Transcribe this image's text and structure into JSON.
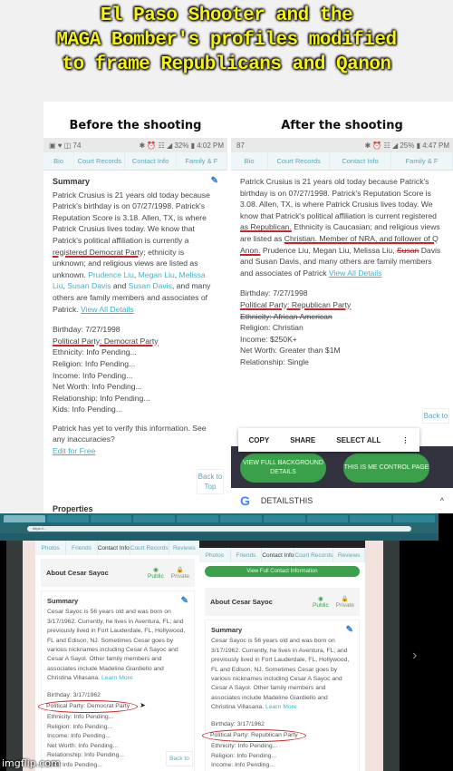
{
  "meme": {
    "title_lines": [
      "El Paso Shooter and the",
      "MAGA Bomber's profiles modified",
      "to frame Republicans and Qanon"
    ],
    "watermark": "imgflip.com",
    "accent_title_color": "#f5f21a",
    "annotation_color": "#c9242b"
  },
  "before": {
    "heading": "Before the shooting",
    "status": {
      "left": "▣ ♥ ◫ 74",
      "right": "✱ ⏰ ☷ ◢ 32% ▮ 4:02 PM"
    },
    "tabs": [
      "Bio",
      "Court Records",
      "Contact Info",
      "Family & F"
    ],
    "summary_label": "Summary",
    "summary": {
      "p1": "Patrick Crusius is 21 years old today because Patrick's birthday is on 07/27/1998. Patrick's Reputation Score is 3.18. Allen, TX, is where Patrick Crusius lives today. We know that Patrick's political affiliation is currently a ",
      "underlined": "registered Democrat Party",
      "p2": "; ethnicity is unknown; and religious views are listed as unknown. ",
      "rel1": "Prudence Liu",
      "rel2": "Megan Liu",
      "rel3": "Melissa Liu",
      "rel4": "Susan Davis",
      "and": " and ",
      "rel5": "Susan Davis",
      "p3": ", and many others are family members and associates of Patrick. ",
      "view_all": "View All Details"
    },
    "facts": [
      "Birthday: 7/27/1998",
      "Political Party: Democrat Party",
      "Ethnicity: Info Pending...",
      "Religion: Info Pending...",
      "Income: Info Pending...",
      "Net Worth: Info Pending...",
      "Relationship: Info Pending...",
      "Kids: Info Pending..."
    ],
    "verify_note": "Patrick has yet to verify this information. See any inaccuracies?",
    "edit_link": "Edit for Free",
    "back_to_top": "Back to Top",
    "properties_label": "Properties"
  },
  "after": {
    "heading": "After the shooting",
    "status": {
      "left": "87",
      "right": "✱ ⏰ ☷ ◢ 25% ▮ 4:47 PM"
    },
    "tabs": [
      "Bio",
      "Court Records",
      "Contact Info",
      "Family & F"
    ],
    "summary": {
      "p1": "Patrick Crusius is 21 years old today because Patrick's birthday is on 07/27/1998. Patrick's Reputation Score is 3.08. Allen, TX, is where Patrick Crusius lives today. We know that Patrick's political affiliation is current registered ",
      "underlined1": "as Republican.",
      "p2": " Ethnicity is Caucasian; and religious views are listed as ",
      "underlined2": "Christian. Member of NRA, and follower of Q Anon.",
      "p3": " Prudence Liu, Megan Liu, Melissa Liu, ",
      "struck": "Susan",
      "p4": " Davis and Susan Davis, and many others are family members and associates of Patrick ",
      "view_all": "View All Details"
    },
    "facts": [
      "Birthday: 7/27/1998",
      "Political Party: Republican Party",
      "Ethnicity: African American",
      "Religion: Christian",
      "Income: $250K+",
      "Net Worth: Greater than $1M",
      "Relationship: Single"
    ],
    "back_to": "Back to",
    "context_menu": [
      "COPY",
      "SHARE",
      "SELECT ALL",
      "⋮"
    ],
    "green_buttons": [
      "VIEW FULL BACKGROUND DETAILS",
      "THIS IS ME CONTROL PAGE"
    ],
    "google_bar": {
      "logo": "G",
      "query": "DETAILSTHIS",
      "caret": "^"
    }
  },
  "sayoc_before": {
    "tabs": [
      "Photos",
      "Friends",
      "Contact Info",
      "Court Records",
      "Reviews"
    ],
    "about": "About Cesar Sayoc",
    "public": "Public",
    "private": "Private",
    "summary_label": "Summary",
    "summary": "Cesar Sayoc is 56 years old and was born on 3/17/1962. Currently, he lives in Aventura, FL; and previously lived in Fort Lauderdale, FL, Hollywood, FL and Edison, NJ. Sometimes Cesar goes by various nicknames including Cesar A Sayoc and Cesar A Sayol. Other family members and associates include Madeline Giardiello and Christina Villasana. ",
    "learn_more": "Learn More",
    "facts": [
      "Birthday: 3/17/1962",
      "Political Party: Democrat Party",
      "Ethnicity: Info Pending...",
      "Religion: Info Pending...",
      "Income: Info Pending...",
      "Net Worth: Info Pending...",
      "Relationship: Info Pending...",
      "Kids: Info Pending..."
    ],
    "back_to": "Back to"
  },
  "sayoc_after": {
    "tabs": [
      "Photos",
      "Friends",
      "Contact Info",
      "Court Records",
      "Reviews"
    ],
    "contact_button": "View Full Contact Information",
    "about": "About Cesar Sayoc",
    "public": "Public",
    "private": "Private",
    "summary_label": "Summary",
    "summary": "Cesar Sayoc is 56 years old and was born on 3/17/1962. Currently, he lives in Aventura, FL; and previously lived in Fort Lauderdale, FL, Hollywood, FL and Edison, NJ. Sometimes Cesar goes by various nicknames including Cesar A Sayoc and Cesar A Sayol. Other family members and associates include Madeline Giardiello and Christina Villasana. ",
    "learn_more": "Learn More",
    "facts": [
      "Birthday: 3/17/1962",
      "Political Party: Republican Party",
      "Ethnicity: Info Pending...",
      "Religion: Info Pending...",
      "Income: Info Pending..."
    ]
  },
  "browser": {
    "tab_count": 10,
    "address": "https://..."
  }
}
